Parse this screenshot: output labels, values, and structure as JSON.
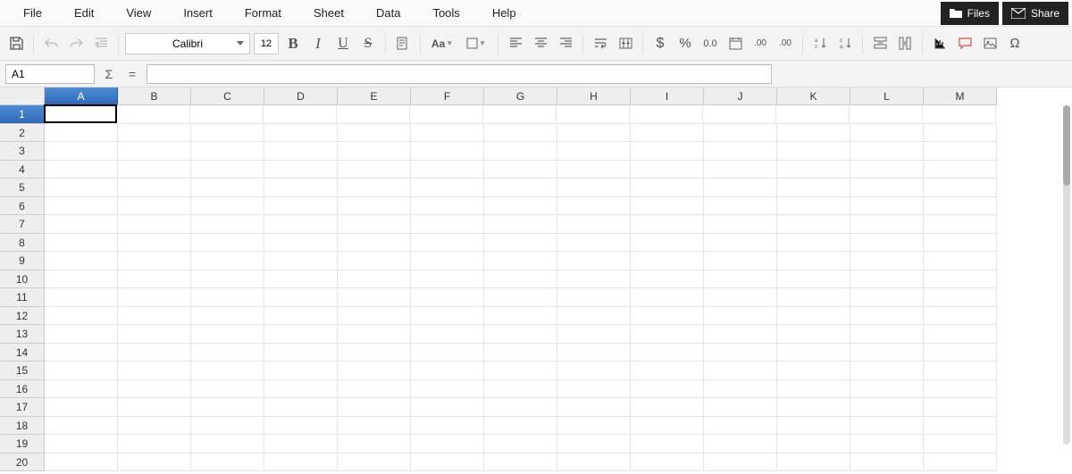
{
  "menu": {
    "items": [
      "File",
      "Edit",
      "View",
      "Insert",
      "Format",
      "Sheet",
      "Data",
      "Tools",
      "Help"
    ],
    "files_btn": "Files",
    "share_btn": "Share"
  },
  "toolbar": {
    "font_name": "Calibri",
    "font_size": "12",
    "char_label": "Aa"
  },
  "formula": {
    "cell_ref": "A1",
    "sigma": "Σ",
    "equals": "=",
    "value": ""
  },
  "grid": {
    "columns": [
      "A",
      "B",
      "C",
      "D",
      "E",
      "F",
      "G",
      "H",
      "I",
      "J",
      "K",
      "L",
      "M"
    ],
    "rows": [
      "1",
      "2",
      "3",
      "4",
      "5",
      "6",
      "7",
      "8",
      "9",
      "10",
      "11",
      "12",
      "13",
      "14",
      "15",
      "16",
      "17",
      "18",
      "19",
      "20"
    ],
    "selected_col": "A",
    "selected_row": "1"
  }
}
